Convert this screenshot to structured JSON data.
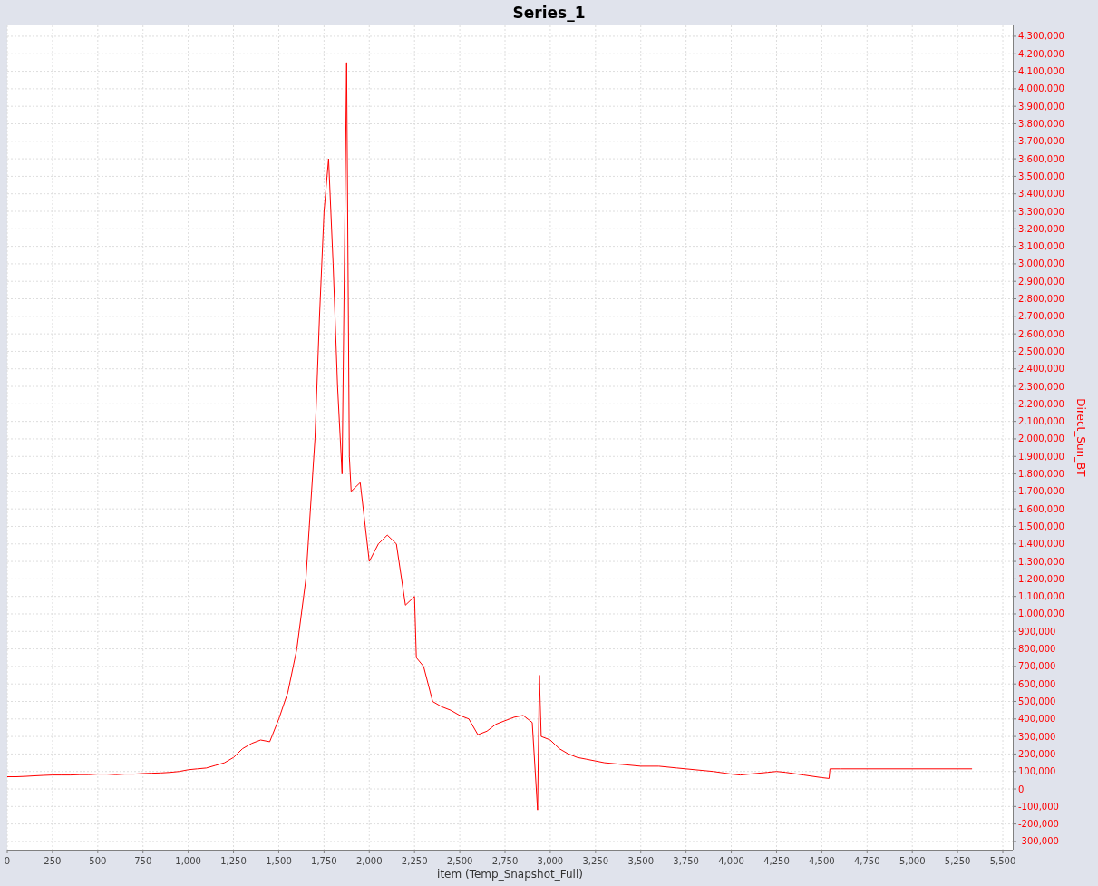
{
  "chart_data": {
    "type": "line",
    "grid": true,
    "xlabel": "item (Temp_Snapshot_Full)",
    "ylabel": "Direct_Sun_BT",
    "xlim": [
      0,
      5555
    ],
    "ylim": [
      -347000,
      4362000
    ],
    "xticks": [
      {
        "value": 0,
        "label": "0"
      },
      {
        "value": 250,
        "label": "250"
      },
      {
        "value": 500,
        "label": "500"
      },
      {
        "value": 750,
        "label": "750"
      },
      {
        "value": 1000,
        "label": "1,000"
      },
      {
        "value": 1250,
        "label": "1,250"
      },
      {
        "value": 1500,
        "label": "1,500"
      },
      {
        "value": 1750,
        "label": "1,750"
      },
      {
        "value": 2000,
        "label": "2,000"
      },
      {
        "value": 2250,
        "label": "2,250"
      },
      {
        "value": 2500,
        "label": "2,500"
      },
      {
        "value": 2750,
        "label": "2,750"
      },
      {
        "value": 3000,
        "label": "3,000"
      },
      {
        "value": 3250,
        "label": "3,250"
      },
      {
        "value": 3500,
        "label": "3,500"
      },
      {
        "value": 3750,
        "label": "3,750"
      },
      {
        "value": 4000,
        "label": "4,000"
      },
      {
        "value": 4250,
        "label": "4,250"
      },
      {
        "value": 4500,
        "label": "4,500"
      },
      {
        "value": 4750,
        "label": "4,750"
      },
      {
        "value": 5000,
        "label": "5,000"
      },
      {
        "value": 5250,
        "label": "5,250"
      },
      {
        "value": 5500,
        "label": "5,500"
      }
    ],
    "yticks": [
      {
        "value": -300000,
        "label": "-300,000"
      },
      {
        "value": -200000,
        "label": "-200,000"
      },
      {
        "value": -100000,
        "label": "-100,000"
      },
      {
        "value": 0,
        "label": "0"
      },
      {
        "value": 100000,
        "label": "100,000"
      },
      {
        "value": 200000,
        "label": "200,000"
      },
      {
        "value": 300000,
        "label": "300,000"
      },
      {
        "value": 400000,
        "label": "400,000"
      },
      {
        "value": 500000,
        "label": "500,000"
      },
      {
        "value": 600000,
        "label": "600,000"
      },
      {
        "value": 700000,
        "label": "700,000"
      },
      {
        "value": 800000,
        "label": "800,000"
      },
      {
        "value": 900000,
        "label": "900,000"
      },
      {
        "value": 1000000,
        "label": "1,000,000"
      },
      {
        "value": 1100000,
        "label": "1,100,000"
      },
      {
        "value": 1200000,
        "label": "1,200,000"
      },
      {
        "value": 1300000,
        "label": "1,300,000"
      },
      {
        "value": 1400000,
        "label": "1,400,000"
      },
      {
        "value": 1500000,
        "label": "1,500,000"
      },
      {
        "value": 1600000,
        "label": "1,600,000"
      },
      {
        "value": 1700000,
        "label": "1,700,000"
      },
      {
        "value": 1800000,
        "label": "1,800,000"
      },
      {
        "value": 1900000,
        "label": "1,900,000"
      },
      {
        "value": 2000000,
        "label": "2,000,000"
      },
      {
        "value": 2100000,
        "label": "2,100,000"
      },
      {
        "value": 2200000,
        "label": "2,200,000"
      },
      {
        "value": 2300000,
        "label": "2,300,000"
      },
      {
        "value": 2400000,
        "label": "2,400,000"
      },
      {
        "value": 2500000,
        "label": "2,500,000"
      },
      {
        "value": 2600000,
        "label": "2,600,000"
      },
      {
        "value": 2700000,
        "label": "2,700,000"
      },
      {
        "value": 2800000,
        "label": "2,800,000"
      },
      {
        "value": 2900000,
        "label": "2,900,000"
      },
      {
        "value": 3000000,
        "label": "3,000,000"
      },
      {
        "value": 3100000,
        "label": "3,100,000"
      },
      {
        "value": 3200000,
        "label": "3,200,000"
      },
      {
        "value": 3300000,
        "label": "3,300,000"
      },
      {
        "value": 3400000,
        "label": "3,400,000"
      },
      {
        "value": 3500000,
        "label": "3,500,000"
      },
      {
        "value": 3600000,
        "label": "3,600,000"
      },
      {
        "value": 3700000,
        "label": "3,700,000"
      },
      {
        "value": 3800000,
        "label": "3,800,000"
      },
      {
        "value": 3900000,
        "label": "3,900,000"
      },
      {
        "value": 4000000,
        "label": "4,000,000"
      },
      {
        "value": 4100000,
        "label": "4,100,000"
      },
      {
        "value": 4200000,
        "label": "4,200,000"
      },
      {
        "value": 4300000,
        "label": "4,300,000"
      }
    ],
    "x": [
      0,
      50,
      100,
      150,
      200,
      250,
      300,
      350,
      400,
      450,
      500,
      550,
      600,
      650,
      700,
      750,
      800,
      850,
      900,
      950,
      1000,
      1050,
      1100,
      1150,
      1200,
      1250,
      1300,
      1350,
      1400,
      1450,
      1500,
      1550,
      1600,
      1650,
      1700,
      1725,
      1750,
      1775,
      1800,
      1825,
      1850,
      1875,
      1890,
      1900,
      1950,
      2000,
      2050,
      2100,
      2150,
      2200,
      2250,
      2260,
      2300,
      2350,
      2400,
      2450,
      2500,
      2550,
      2600,
      2650,
      2700,
      2750,
      2800,
      2850,
      2900,
      2930,
      2940,
      2950,
      3000,
      3050,
      3100,
      3150,
      3200,
      3300,
      3400,
      3500,
      3600,
      3700,
      3800,
      3900,
      4000,
      4050,
      4100,
      4200,
      4250,
      4300,
      4400,
      4500,
      4540,
      4545,
      4600,
      5330
    ],
    "series": [
      {
        "name": "Series_1",
        "color": "#ff0000",
        "values": [
          70000,
          70000,
          72000,
          75000,
          78000,
          80000,
          80000,
          80000,
          82000,
          82000,
          85000,
          85000,
          82000,
          85000,
          85000,
          88000,
          90000,
          92000,
          95000,
          100000,
          110000,
          115000,
          120000,
          135000,
          150000,
          180000,
          230000,
          260000,
          280000,
          270000,
          400000,
          550000,
          800000,
          1200000,
          2000000,
          2700000,
          3300000,
          3600000,
          3000000,
          2300000,
          1800000,
          4150000,
          1900000,
          1700000,
          1750000,
          1300000,
          1400000,
          1450000,
          1400000,
          1050000,
          1100000,
          750000,
          700000,
          500000,
          470000,
          450000,
          420000,
          400000,
          310000,
          330000,
          370000,
          390000,
          410000,
          420000,
          380000,
          -120000,
          650000,
          300000,
          280000,
          230000,
          200000,
          180000,
          170000,
          150000,
          140000,
          130000,
          130000,
          120000,
          110000,
          100000,
          85000,
          80000,
          85000,
          95000,
          100000,
          95000,
          80000,
          65000,
          60000,
          115000,
          115000,
          115000
        ]
      }
    ]
  }
}
